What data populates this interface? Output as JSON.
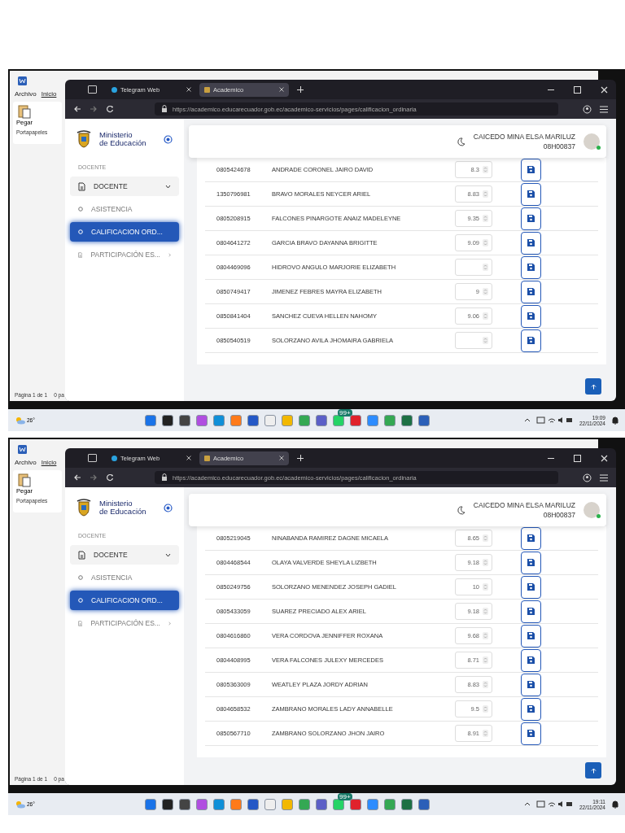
{
  "shots": [
    {
      "word": {
        "menu": [
          {
            "label": "Archivo",
            "selected": false
          },
          {
            "label": "Inicio",
            "selected": true
          }
        ],
        "paste": "Pegar",
        "group": "Portapapeles",
        "status": "Página 1 de 1",
        "status_words": "0 pa"
      },
      "browser": {
        "tabs": [
          {
            "label": "Telegram Web",
            "selected": false
          },
          {
            "label": "Academico",
            "selected": true
          }
        ],
        "url": "https://academico.educarecuador.gob.ec/academico-servicios/pages/calificacion_ordinaria"
      },
      "sidebar": {
        "brand": [
          "Ministerio",
          "de Educación"
        ],
        "section": "DOCENTE",
        "items": [
          {
            "kind": "group",
            "label": "DOCENTE",
            "selected": false
          },
          {
            "kind": "link",
            "label": "ASISTENCIA",
            "selected": false
          },
          {
            "kind": "link",
            "label": "CALIFICACION ORD...",
            "selected": true
          },
          {
            "kind": "submenu",
            "label": "PARTICIPACIÓN ES...",
            "selected": false
          }
        ]
      },
      "user": {
        "name": "CAICEDO MINA ELSA MARILUZ",
        "code": "08H00837",
        "online": true
      },
      "rows": [
        {
          "id": "0805424678",
          "name": "ANDRADE CORONEL JAIRO DAVID",
          "score": "8.3"
        },
        {
          "id": "1350796981",
          "name": "BRAVO MORALES NEYCER ARIEL",
          "score": "8.83"
        },
        {
          "id": "0805208915",
          "name": "FALCONES PINARGOTE ANAIZ MADELEYNE",
          "score": "9.35"
        },
        {
          "id": "0804641272",
          "name": "GARCIA BRAVO DAYANNA BRIGITTE",
          "score": "9.09"
        },
        {
          "id": "0804469096",
          "name": "HIDROVO ANGULO MARJORIE ELIZABETH"
        },
        {
          "id": "0850749417",
          "name": "JIMENEZ FEBRES MAYRA ELIZABETH",
          "score": "9"
        },
        {
          "id": "0850841404",
          "name": "SANCHEZ CUEVA HELLEN NAHOMY",
          "score": "9.06"
        },
        {
          "id": "0850540519",
          "name": "SOLORZANO AVILA JHOMAIRA GABRIELA"
        }
      ],
      "taskbar": {
        "weather": "26°",
        "badge": "99+",
        "time": "19:09",
        "date": "22/11/2024"
      }
    },
    {
      "word": {
        "menu": [
          {
            "label": "Archivo",
            "selected": false
          },
          {
            "label": "Inicio",
            "selected": true
          }
        ],
        "paste": "Pegar",
        "group": "Portapapeles",
        "status": "Página 1 de 1",
        "status_words": "0 pa"
      },
      "browser": {
        "tabs": [
          {
            "label": "Telegram Web",
            "selected": false
          },
          {
            "label": "Academico",
            "selected": true
          }
        ],
        "url": "https://academico.educarecuador.gob.ec/academico-servicios/pages/calificacion_ordinaria"
      },
      "sidebar": {
        "brand": [
          "Ministerio",
          "de Educación"
        ],
        "section": "DOCENTE",
        "items": [
          {
            "kind": "group",
            "label": "DOCENTE",
            "selected": false
          },
          {
            "kind": "link",
            "label": "ASISTENCIA",
            "selected": false
          },
          {
            "kind": "link",
            "label": "CALIFICACION ORD...",
            "selected": true
          },
          {
            "kind": "submenu",
            "label": "PARTICIPACIÓN ES...",
            "selected": false
          }
        ]
      },
      "user": {
        "name": "CAICEDO MINA ELSA MARILUZ",
        "code": "08H00837",
        "online": true
      },
      "rows": [
        {
          "id": "0805219045",
          "name": "NINABANDA RAMIREZ DAGNE MICAELA",
          "score": "8.65"
        },
        {
          "id": "0804468544",
          "name": "OLAYA VALVERDE SHEYLA LIZBETH",
          "score": "9.18"
        },
        {
          "id": "0850249756",
          "name": "SOLORZANO MENENDEZ JOSEPH GADIEL",
          "score": "10"
        },
        {
          "id": "0805433059",
          "name": "SUAREZ PRECIADO ALEX ARIEL",
          "score": "9.18"
        },
        {
          "id": "0804616860",
          "name": "VERA CORDOVA JENNIFFER ROXANA",
          "score": "9.68"
        },
        {
          "id": "0804408995",
          "name": "VERA FALCONES JULEXY MERCEDES",
          "score": "8.71"
        },
        {
          "id": "0805363009",
          "name": "WEATLEY PLAZA JORDY ADRIAN",
          "score": "8.83"
        },
        {
          "id": "0804658532",
          "name": "ZAMBRANO MORALES LADY ANNABELLE",
          "score": "9.5"
        },
        {
          "id": "0850567710",
          "name": "ZAMBRANO SOLORZANO JHON JAIRO",
          "score": "8.91"
        }
      ],
      "taskbar": {
        "weather": "26°",
        "badge": "99+",
        "time": "19:11",
        "date": "22/11/2024"
      }
    }
  ]
}
